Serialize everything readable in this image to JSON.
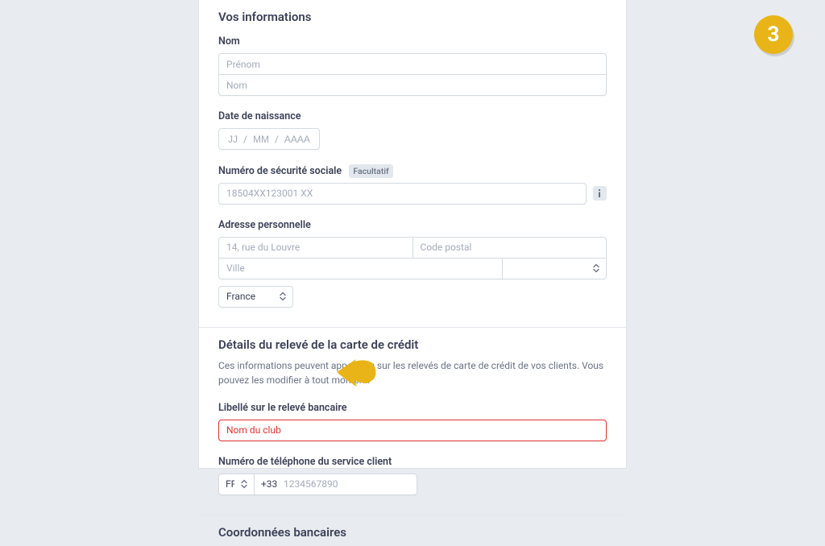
{
  "step_number": "3",
  "sections": {
    "info": {
      "title": "Vos informations",
      "name": {
        "label": "Nom",
        "first_placeholder": "Prénom",
        "last_placeholder": "Nom"
      },
      "dob": {
        "label": "Date de naissance",
        "day_placeholder": "JJ",
        "month_placeholder": "MM",
        "year_placeholder": "AAAA",
        "sep": "/"
      },
      "ssn": {
        "label": "Numéro de sécurité sociale",
        "optional": "Facultatif",
        "placeholder": "18504XX123001 XX"
      },
      "address": {
        "label": "Adresse personnelle",
        "street_placeholder": "14, rue du Louvre",
        "postal_placeholder": "Code postal",
        "city_placeholder": "Ville",
        "state_placeholder": "",
        "country_selected": "France"
      }
    },
    "statement": {
      "title": "Détails du relevé de la carte de crédit",
      "desc": "Ces informations peuvent apparaître sur les relevés de carte de crédit de vos clients. Vous pouvez les modifier à tout moment.",
      "descriptor": {
        "label": "Libellé sur le relevé bancaire",
        "value": "Nom du club"
      },
      "phone": {
        "label": "Numéro de téléphone du service client",
        "country_code": "FR",
        "dial_prefix": "+33",
        "placeholder": "1234567890"
      }
    },
    "bank": {
      "title": "Coordonnées bancaires"
    }
  }
}
